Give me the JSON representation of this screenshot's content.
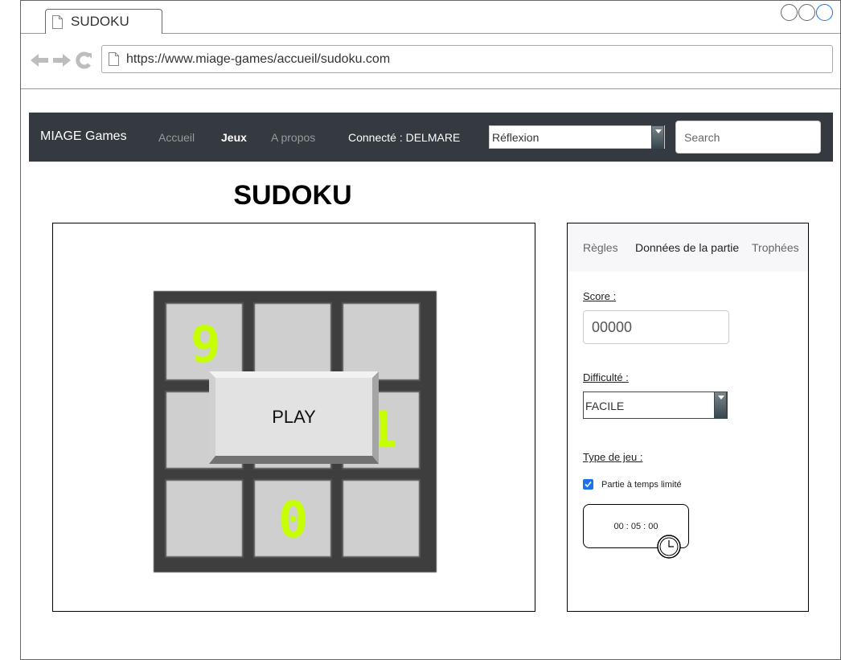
{
  "browser": {
    "tab_title": "SUDOKU",
    "url": "https://www.miage-games/accueil/sudoku.com"
  },
  "navbar": {
    "brand": "MIAGE Games",
    "links": [
      {
        "label": "Accueil",
        "active": false
      },
      {
        "label": "Jeux",
        "active": true
      },
      {
        "label": "A propos",
        "active": false
      }
    ],
    "connected": "Connecté : DELMARE",
    "category_select": "Réflexion",
    "search_placeholder": "Search"
  },
  "page": {
    "title": "SUDOKU"
  },
  "game": {
    "grid": [
      [
        "9",
        "",
        ""
      ],
      [
        "",
        "",
        "1"
      ],
      [
        "",
        "0",
        ""
      ]
    ],
    "play_label": "PLAY",
    "digit_color": "#c6ff00"
  },
  "side": {
    "tabs": [
      {
        "label": "Règles",
        "active": false
      },
      {
        "label": "Données de la partie",
        "active": true
      },
      {
        "label": "Trophées",
        "active": false
      }
    ],
    "score_label": "Score :",
    "score_value": "00000",
    "difficulty_label": "Difficulté :",
    "difficulty_value": "FACILE",
    "game_type_label": "Type de jeu :",
    "timed_label": "Partie à temps limité",
    "timed_checked": true,
    "timer_value": "00 : 05 : 00"
  },
  "colors": {
    "navbar": "#343a40",
    "accent": "#1a73e8"
  }
}
